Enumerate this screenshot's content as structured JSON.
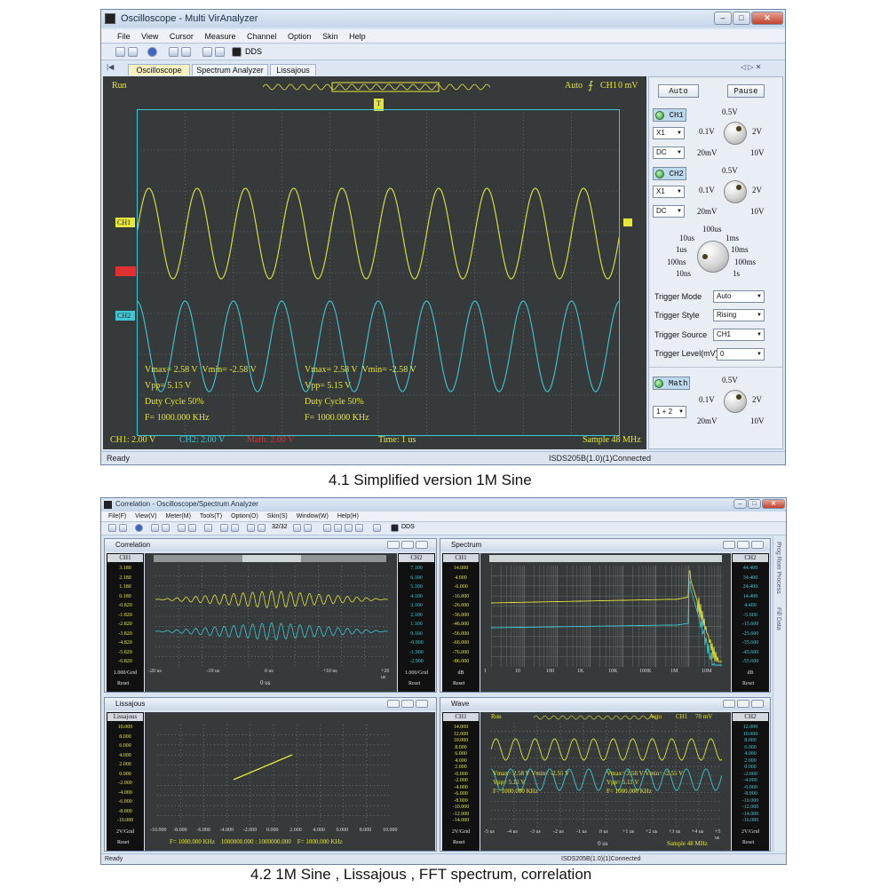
{
  "top": {
    "title": "Oscilloscope - Multi VirAnalyzer",
    "menu": [
      "File",
      "View",
      "Cursor",
      "Measure",
      "Channel",
      "Option",
      "Skin",
      "Help"
    ],
    "dds": "DDS",
    "tabs": [
      "Oscilloscope",
      "Spectrum Analyzer",
      "Lissajous"
    ],
    "run": "Run",
    "trigger_status": "Auto",
    "trigger_channel": "CH1",
    "trigger_level_readout": "0 mV",
    "trigger_marker": "T",
    "ch1_marker": "CH1",
    "math_marker": "Math",
    "ch2_marker": "CH2",
    "meas_ch1": {
      "vmax": "Vmax= 2.58 V",
      "vmin": "Vmin= -2.58 V",
      "vpp": "Vpp= 5.15 V",
      "duty": "Duty Cycle 50%",
      "freq": "F= 1000.000 KHz"
    },
    "meas_ch2": {
      "vmax": "Vmax= 2.58 V",
      "vmin": "Vmin= -2.58 V",
      "vpp": "Vpp= 5.15 V",
      "duty": "Duty Cycle 50%",
      "freq": "F= 1000.000 KHz"
    },
    "bottom_ch1": "CH1: 2.00 V",
    "bottom_ch2": "CH2: 2.00 V",
    "bottom_math": "Math: 2.00 V",
    "bottom_time": "Time: 1 us",
    "bottom_sample": "Sample 48 MHz",
    "status_left": "Ready",
    "status_right": "ISDS205B(1.0)(1)Connected",
    "panel": {
      "auto": "Auto",
      "pause": "Pause",
      "ch1": "CH1",
      "ch2": "CH2",
      "ch1_probe": "X1",
      "ch1_coupling": "DC",
      "ch2_probe": "X1",
      "ch2_coupling": "DC",
      "volt_labels": {
        "top": "0.5V",
        "l": "0.1V",
        "r": "2V",
        "bl": "20mV",
        "br": "10V"
      },
      "time_labels": {
        "t": "100us",
        "tl": "10us",
        "tr": "1ms",
        "l": "1us",
        "r": "10ms",
        "bl": "100ns",
        "br": "100ms",
        "b": "10ns",
        "b2": "1s"
      },
      "trigger_mode_label": "Trigger Mode",
      "trigger_mode": "Auto",
      "trigger_style_label": "Trigger Style",
      "trigger_style": "Rising",
      "trigger_source_label": "Trigger Source",
      "trigger_source": "CH1",
      "trigger_level_label": "Trigger Level(mV)",
      "trigger_level": "0",
      "math": "Math",
      "math_op": "1 + 2"
    }
  },
  "caption1": "4.1 Simplified version 1M Sine",
  "bottom": {
    "title": "Correlation - Oscilloscope/Spectrum Analyzer",
    "menu": [
      "File(F)",
      "View(V)",
      "Meter(M)",
      "Tools(T)",
      "Option(O)",
      "Skin(S)",
      "Window(W)",
      "Help(H)"
    ],
    "counter": "32/32",
    "dds": "DDS",
    "side_tabs": "Prog Rom Process",
    "side_tabs2": "Fill Data",
    "correlation": {
      "title": "Correlation",
      "ch1": "CH1",
      "ch2": "CH2",
      "left_ticks": [
        "3.180",
        "2.180",
        "1.180",
        "0.180",
        "-0.820",
        "-1.820",
        "-2.820",
        "-3.820",
        "-4.820",
        "-5.820",
        "-6.820"
      ],
      "right_ticks": [
        "7.100",
        "6.100",
        "5.100",
        "4.100",
        "3.100",
        "2.100",
        "1.100",
        "0.100",
        "-0.900",
        "-1.900",
        "-2.900"
      ],
      "x_ticks": [
        "-20 us",
        "-10 us",
        "0 us",
        "+10 us",
        "+20 us"
      ],
      "x_center": "0 us",
      "grid_left": "1.000/Grid",
      "grid_right": "1.000/Grid",
      "reset": "Reset"
    },
    "spectrum": {
      "title": "Spectrum",
      "ch1": "CH1",
      "ch2": "CH2",
      "left_ticks": [
        "14.000",
        "4.000",
        "-6.000",
        "-16.000",
        "-26.000",
        "-36.000",
        "-46.000",
        "-56.000",
        "-66.000",
        "-76.000",
        "-86.000"
      ],
      "right_ticks": [
        "44.400",
        "34.400",
        "24.400",
        "14.400",
        "4.400",
        "-5.600",
        "-15.600",
        "-25.600",
        "-35.600",
        "-45.600",
        "-55.600"
      ],
      "x_ticks": [
        "1",
        "10",
        "100",
        "1K",
        "10K",
        "100K",
        "1M",
        "10M"
      ],
      "grid_left": "dB",
      "grid_right": "dB",
      "reset": "Reset"
    },
    "lissajous": {
      "title": "Lissajous",
      "ch1": "Lissajous",
      "left_ticks": [
        "10.000",
        "8.000",
        "6.000",
        "4.000",
        "2.000",
        "0.000",
        "-2.000",
        "-4.000",
        "-6.000",
        "-8.000",
        "-10.000"
      ],
      "x_ticks": [
        "-10.000",
        "-8.000",
        "-6.000",
        "-4.000",
        "-2.000",
        "0.000",
        "2.000",
        "4.000",
        "6.000",
        "8.000",
        "10.000"
      ],
      "freq_line": "F= 1000.000 KHz    1000000.000 : 1000000.000    F= 1000.000 KHz",
      "grid_left": "2V/Grid",
      "reset": "Reset"
    },
    "wave": {
      "title": "Wave",
      "ch1": "CH1",
      "ch2": "CH2",
      "run": "Run",
      "auto": "Auto",
      "trig": "CH1",
      "trig_level": "78 mV",
      "left_ticks": [
        "14.000",
        "12.000",
        "10.000",
        "8.000",
        "6.000",
        "4.000",
        "2.000",
        "-0.000",
        "-2.000",
        "-4.000",
        "-6.000",
        "-8.000",
        "-10.000",
        "-12.000",
        "-14.000"
      ],
      "right_ticks": [
        "12.000",
        "10.000",
        "8.000",
        "6.000",
        "4.000",
        "2.000",
        "0.000",
        "-2.000",
        "-4.000",
        "-6.000",
        "-8.000",
        "-10.000",
        "-12.000",
        "-14.000",
        "-16.000"
      ],
      "x_ticks": [
        "-5 us",
        "-4 us",
        "-3 us",
        "-2 us",
        "-1 us",
        "0 us",
        "+1 us",
        "+2 us",
        "+3 us",
        "+4 us",
        "+5 us"
      ],
      "x_center": "0 us",
      "meas1": {
        "vmax": "Vmax= 2.58 V",
        "vmin": "Vmin= -2.55 V",
        "vpp": "Vpp= 5.11 V",
        "freq": "F= 1000.000 KHz"
      },
      "meas2": {
        "vmax": "Vmax= 2.58 V",
        "vmin": "Vmin= -2.55 V",
        "vpp": "Vpp= 5.11 V",
        "freq": "F= 1000.000 KHz"
      },
      "sample": "Sample 48 MHz",
      "grid_left": "2V/Grid",
      "grid_right": "2V/Grid",
      "reset": "Reset"
    },
    "status_left": "Ready",
    "status_right": "ISDS205B(1.0)(1)Connected"
  },
  "caption2": "4.2  1M Sine , Lissajous , FFT spectrum, correlation",
  "colors": {
    "ch1": "#e6e63a",
    "ch2": "#3ec8d6",
    "math": "#e03030",
    "scope_bg": "#363a3a",
    "grid": "#7a7e7e"
  }
}
